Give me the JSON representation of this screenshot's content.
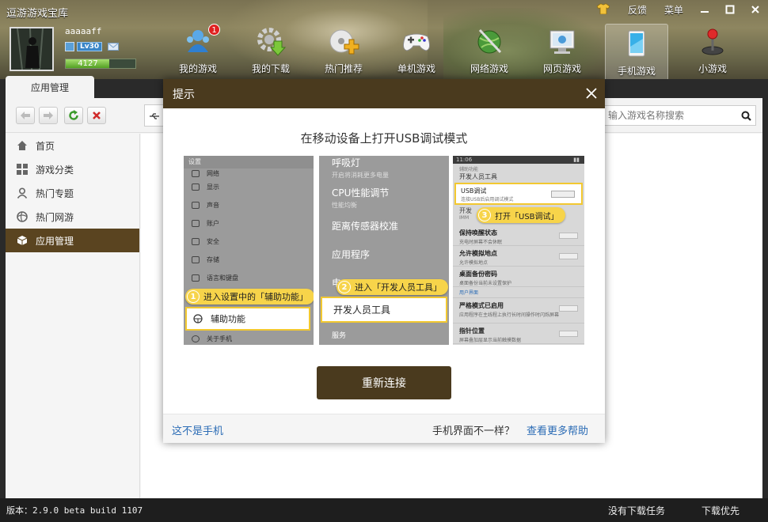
{
  "app": {
    "title": "逗游游戏宝库",
    "feedback": "反馈",
    "menu": "菜单"
  },
  "user": {
    "name": "aaaaaff",
    "level": "Lv30",
    "xp": "4127",
    "xp_progress": 0.62
  },
  "nav": {
    "items": [
      {
        "label": "我的游戏",
        "badge": "1"
      },
      {
        "label": "我的下载"
      },
      {
        "label": "热门推荐"
      },
      {
        "label": "单机游戏"
      },
      {
        "label": "网络游戏"
      },
      {
        "label": "网页游戏"
      },
      {
        "label": "手机游戏"
      },
      {
        "label": "小游戏"
      }
    ]
  },
  "tab": {
    "label": "应用管理"
  },
  "search": {
    "placeholder": "输入游戏名称搜索"
  },
  "sidebar": {
    "items": [
      {
        "label": "首页"
      },
      {
        "label": "游戏分类"
      },
      {
        "label": "热门专题"
      },
      {
        "label": "热门网游"
      },
      {
        "label": "应用管理"
      }
    ]
  },
  "dialog": {
    "title": "提示",
    "heading": "在移动设备上打开USB调试模式",
    "shot1": {
      "header": "设置",
      "rows": [
        "网络",
        "显示",
        "声音",
        "账户",
        "安全",
        "存储",
        "语言和键盘"
      ],
      "callout": "进入设置中的「辅助功能」",
      "callout_num": "1",
      "highlight": "辅助功能",
      "after": "关于手机"
    },
    "shot2": {
      "items": [
        {
          "title": "呼吸灯",
          "sub": "开启将消耗更多电量"
        },
        {
          "title": "CPU性能调节",
          "sub": "性能均衡"
        },
        {
          "title": "距离传感器校准",
          "sub": ""
        },
        {
          "title": "应用程序",
          "sub": ""
        }
      ],
      "partial": "电",
      "callout": "进入「开发人员工具」",
      "callout_num": "2",
      "highlight": "开发人员工具",
      "after": "服务"
    },
    "shot3": {
      "time": "11:06",
      "crumb": "辅助功能",
      "header": "开发人员工具",
      "usb_title": "USB调试",
      "usb_desc": "连接USB后启用调试模式",
      "partial": "开发",
      "partial_sub": "IMM",
      "callout": "打开「USB调试」",
      "callout_num": "3",
      "rows": [
        {
          "t": "保持唤醒状态",
          "d": "充电时屏幕不会休眠"
        },
        {
          "t": "允许模拟地点",
          "d": "允许模拟地点"
        },
        {
          "t": "桌面备份密码",
          "d": "桌面备份当前未设置保护"
        }
      ],
      "section": "用户界面",
      "rows2": [
        {
          "t": "严格模式已启用",
          "d": "应用程序在主线程上执行长时间操作时闪烁屏幕"
        },
        {
          "t": "指针位置",
          "d": "屏幕叠加层显示当前触摸数据"
        }
      ]
    },
    "reconnect": "重新连接",
    "not_phone": "这不是手机",
    "diff_text": "手机界面不一样？",
    "more_help": "查看更多帮助"
  },
  "status": {
    "version": "版本：2.9.0 beta build 1107",
    "no_tasks": "没有下载任务",
    "priority": "下载优先"
  }
}
